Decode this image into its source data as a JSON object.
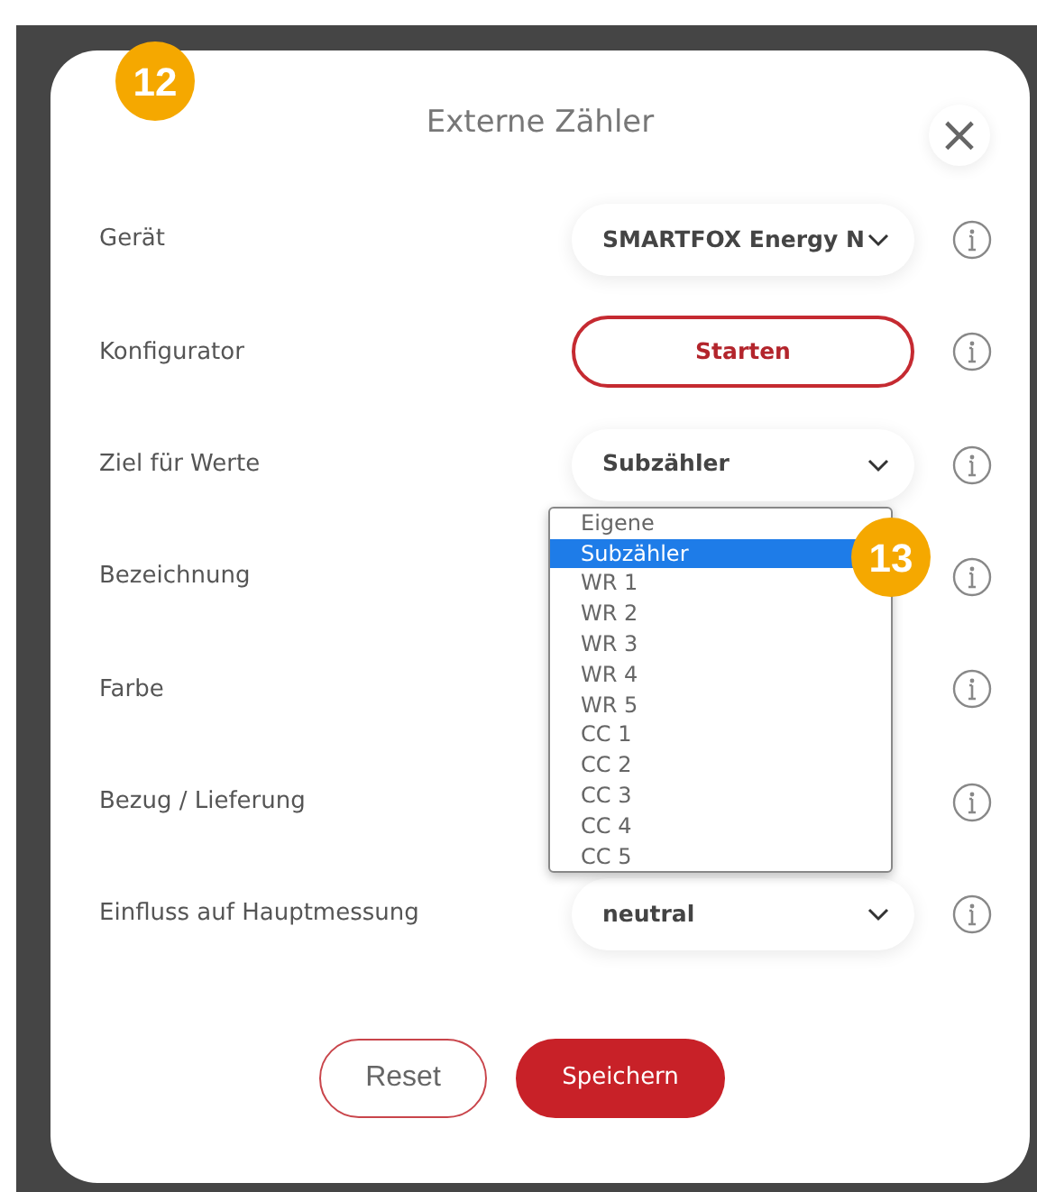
{
  "badges": [
    "12",
    "13"
  ],
  "dialog": {
    "title": "Externe Zähler",
    "close": "×"
  },
  "rows": [
    {
      "label": "Gerät",
      "kind": "select",
      "value": "SMARTFOX Energy N"
    },
    {
      "label": "Konfigurator",
      "kind": "button",
      "value": "Starten"
    },
    {
      "label": "Ziel für Werte",
      "kind": "select",
      "value": "Subzähler",
      "expanded": true
    },
    {
      "label": "Bezeichnung",
      "kind": "hidden"
    },
    {
      "label": "Farbe",
      "kind": "hidden"
    },
    {
      "label": "Bezug / Lieferung",
      "kind": "hidden"
    },
    {
      "label": "Einfluss auf Hauptmessung",
      "kind": "select",
      "value": "neutral"
    }
  ],
  "dropdown_options": [
    {
      "label": "Eigene",
      "selected": false
    },
    {
      "label": "Subzähler",
      "selected": true
    },
    {
      "label": "WR 1",
      "selected": false
    },
    {
      "label": "WR 2",
      "selected": false
    },
    {
      "label": "WR 3",
      "selected": false
    },
    {
      "label": "WR 4",
      "selected": false
    },
    {
      "label": "WR 5",
      "selected": false
    },
    {
      "label": "CC 1",
      "selected": false
    },
    {
      "label": "CC 2",
      "selected": false
    },
    {
      "label": "CC 3",
      "selected": false
    },
    {
      "label": "CC 4",
      "selected": false
    },
    {
      "label": "CC 5",
      "selected": false
    }
  ],
  "buttons": [
    {
      "label": "Reset",
      "kind": "outline"
    },
    {
      "label": "Speichern",
      "kind": "primary"
    }
  ]
}
